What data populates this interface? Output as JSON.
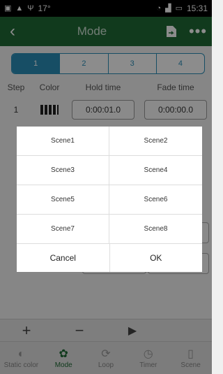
{
  "status_bar": {
    "temperature": "17°",
    "time": "15:31"
  },
  "app_bar": {
    "title": "Mode"
  },
  "tabs": [
    "1",
    "2",
    "3",
    "4"
  ],
  "columns": {
    "step": "Step",
    "color": "Color",
    "hold": "Hold time",
    "fade": "Fade time"
  },
  "rows": [
    {
      "step": "1",
      "hold": "0:00:01.0",
      "fade": "0:00:00.0"
    }
  ],
  "bottom_nav": [
    {
      "label": "Static color",
      "icon": "palette-icon",
      "active": false
    },
    {
      "label": "Mode",
      "icon": "mode-icon",
      "active": true
    },
    {
      "label": "Loop",
      "icon": "loop-icon",
      "active": false
    },
    {
      "label": "Timer",
      "icon": "timer-icon",
      "active": false
    },
    {
      "label": "Scene",
      "icon": "scene-icon",
      "active": false
    }
  ],
  "dialog": {
    "scenes": [
      "Scene1",
      "Scene2",
      "Scene3",
      "Scene4",
      "Scene5",
      "Scene6",
      "Scene7",
      "Scene8"
    ],
    "cancel_label": "Cancel",
    "ok_label": "OK"
  },
  "colors": {
    "app_bar": "#1f6b36",
    "accent": "#2a8fb8"
  }
}
